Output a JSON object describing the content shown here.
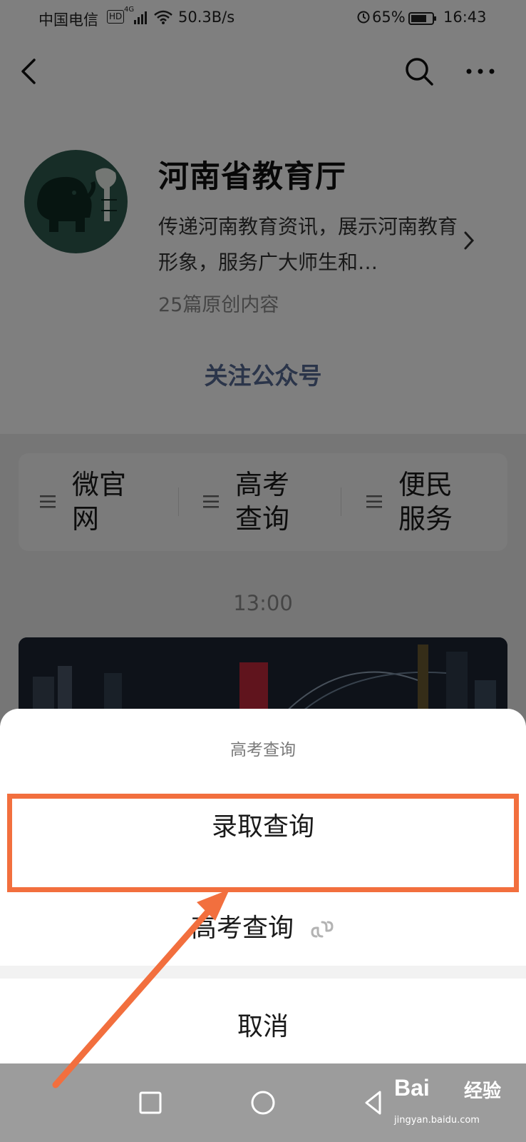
{
  "status_bar": {
    "carrier": "中国电信",
    "hd": "HD",
    "network": "4G",
    "speed": "50.3B/s",
    "battery_percent": "65%",
    "time": "16:43"
  },
  "account": {
    "name": "河南省教育厅",
    "description": "传递河南教育资讯，展示河南教育形象，服务广大师生和…",
    "stats": "25篇原创内容",
    "follow_label": "关注公众号"
  },
  "menu": {
    "items": [
      {
        "label": "微官网"
      },
      {
        "label": "高考查询"
      },
      {
        "label": "便民服务"
      }
    ]
  },
  "feed": {
    "time": "13:00"
  },
  "action_sheet": {
    "title": "高考查询",
    "options": [
      {
        "label": "录取查询"
      },
      {
        "label": "高考查询"
      }
    ],
    "cancel_label": "取消"
  },
  "watermark": {
    "logo": "Bai",
    "brand": "经验",
    "url": "jingyan.baidu.com"
  },
  "colors": {
    "highlight": "#f26f3e",
    "link": "#576b95",
    "avatar_bg": "#2e5a4f"
  },
  "icons": [
    "back-icon",
    "search-icon",
    "more-icon",
    "menu-list-icon",
    "chevron-right-icon",
    "mini-program-icon",
    "square-nav-icon",
    "circle-nav-icon",
    "triangle-nav-icon"
  ]
}
